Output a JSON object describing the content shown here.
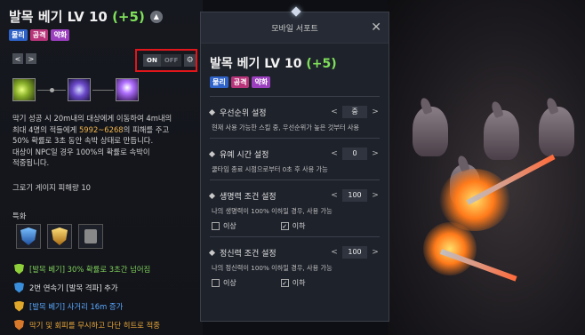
{
  "skill": {
    "title": "발목 베기 LV 10",
    "plus": "(+5)",
    "tags": [
      "물리",
      "공격",
      "약화"
    ],
    "description_lines": [
      "막기 성공 시 20m내의 대상에게 이동하여 4m내의",
      "최대 4명의 적들에게 ",
      "5992~6268",
      "의 피해를 주고",
      "50% 확률로 3초 동안 속박 상태로 만듭니다.",
      "대상이 NPC일 경우 100%의 확률로 속박이",
      "적중됩니다."
    ],
    "gauge": "그로기 게이지 피해량 10",
    "toggle_on": "ON",
    "toggle_off": "OFF",
    "nav_prev": "<",
    "nav_next": ">"
  },
  "mods": {
    "section_title": "특화",
    "items": [
      {
        "text": "[발목 베기] 30% 확률로 3초간 넘어짐",
        "color": "#7fcf5a"
      },
      {
        "text": "2번 연속기 [발목 격파] 추가",
        "color": "#e0e0e0"
      },
      {
        "text": "[발목 베기] 사거리 16m 증가",
        "color": "#5aa8ff"
      },
      {
        "text": "막기 및 회피를 무시하고 다단 히트로 적중",
        "color": "#e8a63a"
      }
    ]
  },
  "panel": {
    "title": "모바일 서포트",
    "close": "✕",
    "skill_title": "발목 베기 LV 10",
    "skill_plus": "(+5)",
    "tags": [
      "물리",
      "공격",
      "약화"
    ],
    "settings": [
      {
        "label": "우선순위 설정",
        "value": "중",
        "desc": "현재 사용 가능한 스킬 중, 우선순위가 높은 것부터 사용"
      },
      {
        "label": "유예 시간 설정",
        "value": "0",
        "desc": "쿨타임 종료 시점으로부터 0초 후 사용 가능"
      },
      {
        "label": "생명력 조건 설정",
        "value": "100",
        "desc": "나의 생명력이 100% 이하일 경우, 사용 가능",
        "check_a": "이상",
        "check_b": "이하"
      },
      {
        "label": "정신력 조건 설정",
        "value": "100",
        "desc": "나의 정신력이 100% 이하일 경우, 사용 가능",
        "check_a": "이상",
        "check_b": "이하"
      }
    ]
  }
}
